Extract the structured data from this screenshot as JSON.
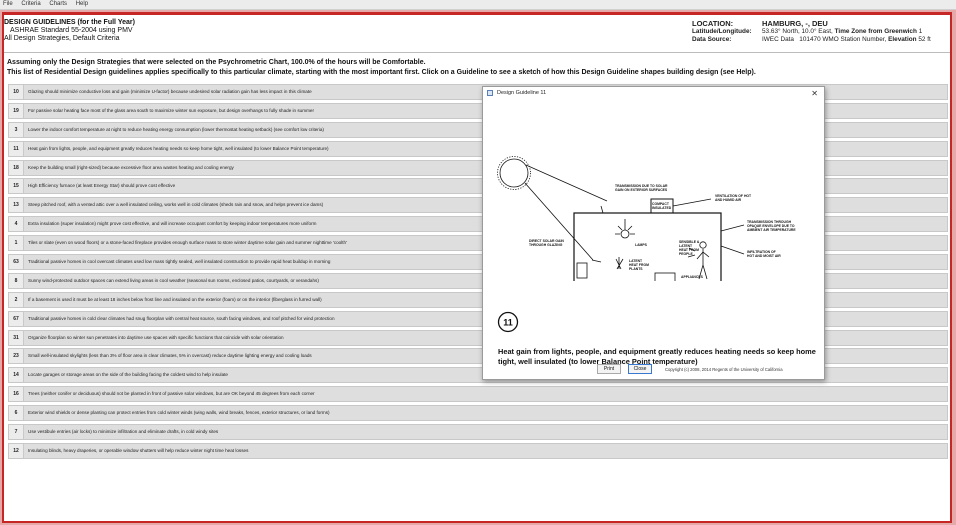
{
  "menu": [
    "File",
    "Criteria",
    "Charts",
    "Help"
  ],
  "header": {
    "title": "DESIGN GUIDELINES (for the Full Year)",
    "standard": "ASHRAE Standard 55-2004 using PMV",
    "criteria": "All Design Strategies, Default Criteria"
  },
  "location": {
    "location_label": "LOCATION:",
    "location_value": "HAMBURG, -, DEU",
    "latlon_label": "Latitude/Longitude:",
    "latlon_value": "53.63° North, 10.0° East,",
    "tz_label": "Time Zone from Greenwich",
    "tz_value": "1",
    "source_label": "Data Source:",
    "source_value": "IWEC Data",
    "station_value": "101470 WMO Station Number,",
    "elev_label": "Elevation",
    "elev_value": "52 ft"
  },
  "intro": {
    "line1": "Assuming only the Design Strategies that were selected on the Psychrometric Chart, 100.0% of the hours will be Comfortable.",
    "line2": "This list of Residential Design guidelines applies specifically to this particular climate, starting with the most important first.  Click on a Guideline to see a sketch of how this Design Guideline shapes building design (see Help)."
  },
  "guidelines": [
    {
      "num": "10",
      "text": "Glazing should minimize conductive loss and gain (minimize U-factor) because undesired solar radiation gain has less impact in this climate"
    },
    {
      "num": "19",
      "text": "For passive solar heating face most of the glass area south to maximize winter sun exposure, but design overhangs to fully shade in summer"
    },
    {
      "num": "3",
      "text": "Lower the indoor comfort temperature at night to reduce heating energy consumption (lower thermostat heating setback) (see comfort low criteria)"
    },
    {
      "num": "11",
      "text": "Heat gain from lights, people, and equipment greatly reduces heating needs so keep home tight, well insulated (to lower Balance Point temperature)"
    },
    {
      "num": "18",
      "text": "Keep the building small (right-sized) because excessive floor area wastes heating and cooling energy"
    },
    {
      "num": "15",
      "text": "High Efficiency furnace (at least Energy Star) should prove cost effective"
    },
    {
      "num": "13",
      "text": "Steep pitched roof, with a vented attic over a well insulated ceiling, works well in cold climates (sheds rain and snow, and helps prevent ice dams)"
    },
    {
      "num": "4",
      "text": "Extra insulation (super insulation) might prove cost effective, and will increase occupant comfort by keeping indoor temperatures more uniform"
    },
    {
      "num": "1",
      "text": "Tiles or slate (even on wood floors) or a stone-faced fireplace provides enough surface mass to store winter daytime solar gain and summer nighttime 'coolth'"
    },
    {
      "num": "63",
      "text": "Traditional passive homes in cool overcast climates used low mass tightly sealed, well insulated construction to provide rapid heat buildup in morning"
    },
    {
      "num": "8",
      "text": "Sunny wind-protected outdoor spaces can extend living areas in cool weather (seasonal sun rooms, enclosed patios, courtyards, or verandahs)"
    },
    {
      "num": "2",
      "text": "If a basement is used it must be at least 18 inches below frost line and insulated on the exterior (foam) or on the interior (fiberglass in furred wall)"
    },
    {
      "num": "67",
      "text": "Traditional passive homes in cold clear climates had snug floorplan with central heat source, south facing windows, and roof pitched for wind protection"
    },
    {
      "num": "31",
      "text": "Organize floorplan so winter sun penetrates into daytime use spaces with specific functions that coincide with solar orientation"
    },
    {
      "num": "23",
      "text": "Small well-insulated skylights (less than 3% of floor area in clear climates, 5% in overcast) reduce daytime lighting energy and cooling loads"
    },
    {
      "num": "14",
      "text": "Locate garages or storage areas on the side of the building facing the coldest wind to help insulate"
    },
    {
      "num": "16",
      "text": "Trees (neither conifer or deciduous) should not be planted in front of passive solar windows, but are OK beyond 45 degrees from each corner"
    },
    {
      "num": "6",
      "text": "Exterior wind shields or dense planting can protect entries from cold winter winds (wing walls, wind breaks, fences, exterior structures, or land forms)"
    },
    {
      "num": "7",
      "text": "Use vestibule entries (air locks) to minimize infiltration and eliminate drafts, in cold windy sites"
    },
    {
      "num": "12",
      "text": "Insulating blinds, heavy draperies, or operable window shutters will help reduce winter night time heat losses"
    }
  ],
  "dialog": {
    "title": "Design Guideline 11",
    "close_glyph": "✕",
    "number": "11",
    "caption": "Heat gain from lights, people, and equipment greatly reduces heating needs so keep home tight, well insulated (to lower Balance Point temperature)",
    "print_label": "Print",
    "close_label": "Close",
    "copyright": "Copyright (c) 2008, 2014 Regents of the University of California",
    "sketch_labels": {
      "solar_exterior": [
        "TRANSMISSION DUE TO SOLAR",
        "GAIN ON EXTERIOR SURFACES"
      ],
      "ventilation": [
        "VENTILATION OF HOT",
        "AND HUMID AIR"
      ],
      "compact": [
        "COMPACT",
        "INSULATED"
      ],
      "opaque": [
        "TRANSMISSION THROUGH",
        "OPAQUE ENVELOPE DUE TO",
        "AMBIENT AIR TEMPERATURE"
      ],
      "lamps": [
        "LAMPS"
      ],
      "direct_solar": [
        "DIRECT SOLAR GAIN",
        "THROUGH GLAZING"
      ],
      "people": [
        "SENSIBLE &",
        "LATENT",
        "HEAT FROM",
        "PEOPLE"
      ],
      "infiltration": [
        "INFILTRATION OF",
        "HOT AND MOIST AIR"
      ],
      "plants": [
        "LATENT",
        "HEAT FROM",
        "PLANTS"
      ],
      "appliances": [
        "APPLIANCES"
      ]
    }
  },
  "colors": {
    "frame": "#c62626",
    "background": "#e6a9a9",
    "row": "#dedede",
    "close_border": "#3a78d0"
  }
}
